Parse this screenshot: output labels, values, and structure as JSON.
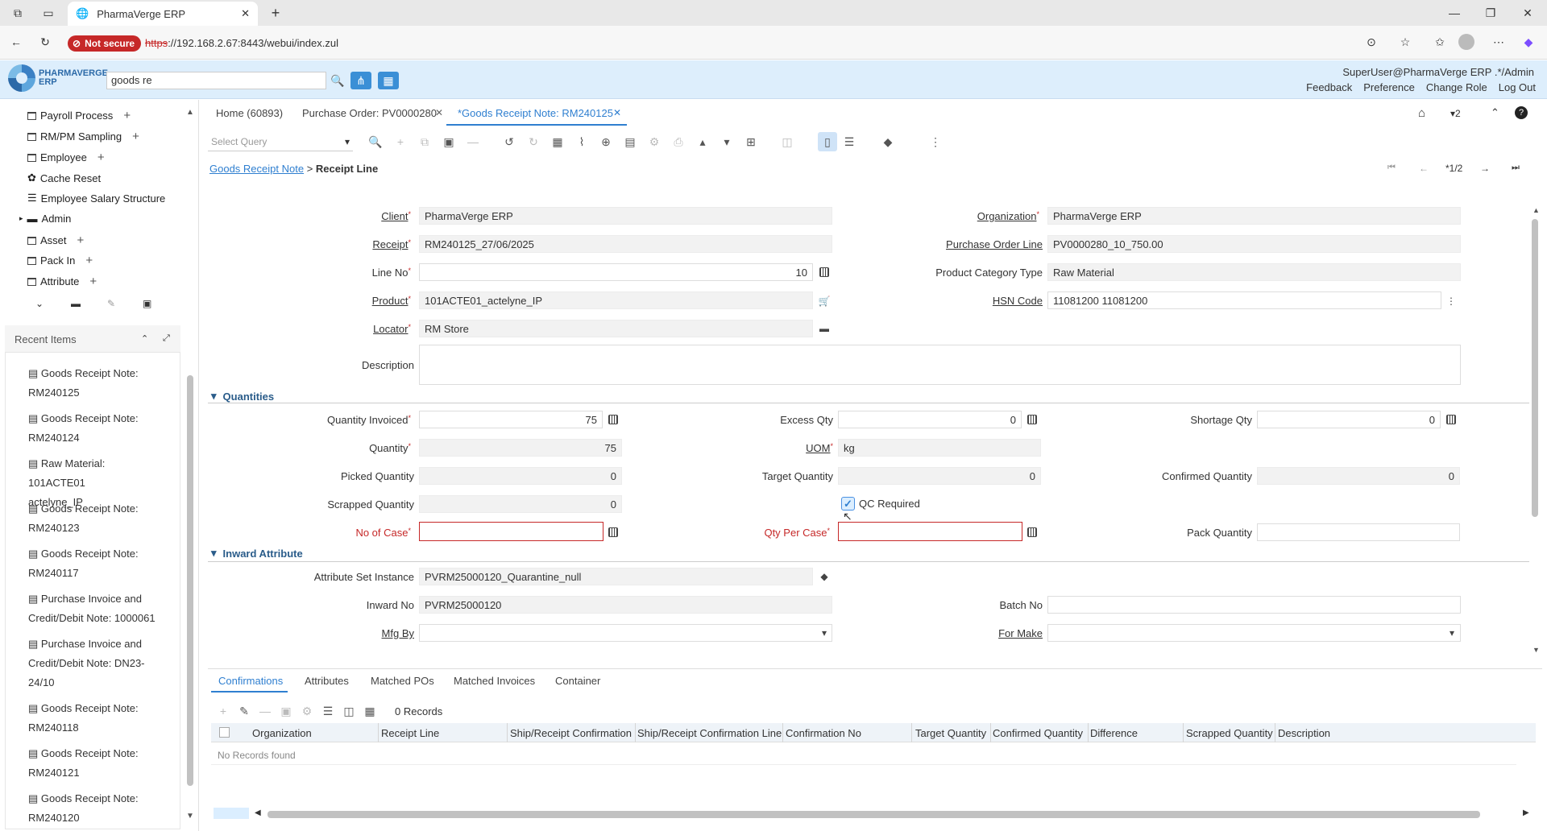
{
  "browser": {
    "tab_title": "PharmaVerge ERP",
    "not_secure": "Not secure",
    "url_scheme": "https",
    "url_rest": "://192.168.2.67:8443/webui/index.zul"
  },
  "header": {
    "logo_line1": "PHARMAVERGE",
    "logo_line2": "ERP",
    "search_value": "goods re",
    "user": "SuperUser@PharmaVerge ERP .*/Admin",
    "links": [
      "Feedback",
      "Preference",
      "Change Role",
      "Log Out"
    ]
  },
  "sidebar": {
    "items": [
      "Payroll Process",
      "RM/PM Sampling",
      "Employee",
      "Cache Reset",
      "Employee Salary Structure",
      "Admin",
      "Asset",
      "Pack In",
      "Attribute"
    ],
    "recent_title": "Recent Items",
    "recent": [
      {
        "line1": "Goods Receipt Note:",
        "line2": "RM240125"
      },
      {
        "line1": "Goods Receipt Note:",
        "line2": "RM240124"
      },
      {
        "line1": "Raw Material: 101ACTE01",
        "line2": "actelyne_IP"
      },
      {
        "line1": "Goods Receipt Note:",
        "line2": "RM240123"
      },
      {
        "line1": "Goods Receipt Note:",
        "line2": "RM240117"
      },
      {
        "line1": "Purchase Invoice and",
        "line2": "Credit/Debit Note: 1000061"
      },
      {
        "line1": "Purchase Invoice and",
        "line2": "Credit/Debit Note: DN23-",
        "line3": "24/10"
      },
      {
        "line1": "Goods Receipt Note:",
        "line2": "RM240118"
      },
      {
        "line1": "Goods Receipt Note:",
        "line2": "RM240121"
      },
      {
        "line1": "Goods Receipt Note:",
        "line2": "RM240120"
      }
    ]
  },
  "window_tabs": [
    "Home (60893)",
    "Purchase Order: PV0000280",
    "*Goods Receipt Note: RM240125"
  ],
  "toolbar": {
    "query_placeholder": "Select Query",
    "nav_count": "2",
    "record_pos": "*1/2"
  },
  "breadcrumb": {
    "parent": "Goods Receipt Note",
    "sep": ">",
    "current": "Receipt Line"
  },
  "form": {
    "client_label": "Client",
    "client": "PharmaVerge ERP",
    "org_label": "Organization",
    "org": "PharmaVerge ERP",
    "receipt_label": "Receipt",
    "receipt": "RM240125_27/06/2025",
    "pol_label": "Purchase Order Line",
    "pol": "PV0000280_10_750.00",
    "lineno_label": "Line No",
    "lineno": "10",
    "pct_label": "Product Category Type",
    "pct": "Raw Material",
    "product_label": "Product",
    "product": "101ACTE01_actelyne_IP",
    "hsn_label": "HSN Code",
    "hsn": "11081200 11081200",
    "locator_label": "Locator",
    "locator": "RM Store",
    "desc_label": "Description",
    "desc": ""
  },
  "quantities": {
    "title": "Quantities",
    "qty_inv_label": "Quantity Invoiced",
    "qty_inv": "75",
    "excess_label": "Excess Qty",
    "excess": "0",
    "shortage_label": "Shortage Qty",
    "shortage": "0",
    "qty_label": "Quantity",
    "qty": "75",
    "uom_label": "UOM",
    "uom": "kg",
    "picked_label": "Picked Quantity",
    "picked": "0",
    "target_label": "Target Quantity",
    "target": "0",
    "confirmed_label": "Confirmed Quantity",
    "confirmed": "0",
    "scrapped_label": "Scrapped Quantity",
    "scrapped": "0",
    "qc_label": "QC Required",
    "qc_checked": true,
    "case_label": "No of Case",
    "case": "",
    "qpc_label": "Qty Per Case",
    "qpc": "",
    "pack_label": "Pack Quantity",
    "pack": ""
  },
  "inward": {
    "title": "Inward Attribute",
    "asi_label": "Attribute Set Instance",
    "asi": "PVRM25000120_Quarantine_null",
    "inward_label": "Inward No",
    "inward": "PVRM25000120",
    "batch_label": "Batch No",
    "batch": "",
    "mfgby_label": "Mfg By",
    "mfgby": "",
    "formake_label": "For Make",
    "formake": ""
  },
  "detail": {
    "tabs": [
      "Confirmations",
      "Attributes",
      "Matched POs",
      "Matched Invoices",
      "Container"
    ],
    "records": "0 Records",
    "columns": [
      "Organization",
      "Receipt Line",
      "Ship/Receipt Confirmation",
      "Ship/Receipt Confirmation Line",
      "Confirmation No",
      "Target Quantity",
      "Confirmed Quantity",
      "Difference",
      "Scrapped Quantity",
      "Description"
    ],
    "empty": "No Records found"
  }
}
